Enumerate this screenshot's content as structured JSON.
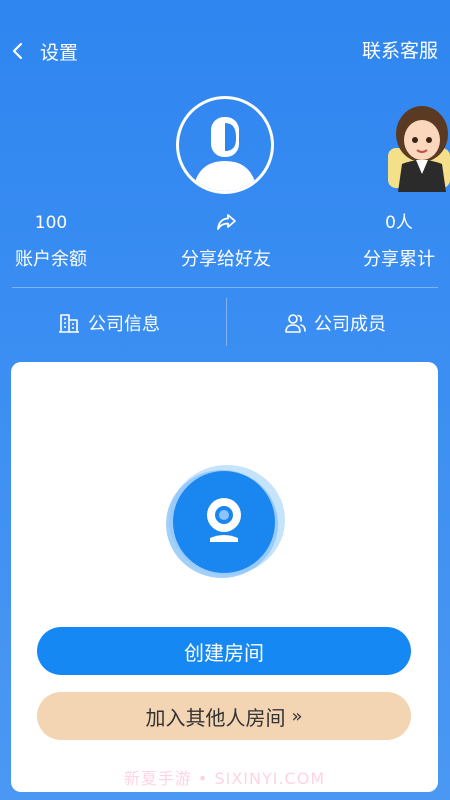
{
  "header": {
    "back_label": "设置",
    "support_label": "联系客服"
  },
  "stats": {
    "balance_value": "100",
    "balance_label": "账户余额",
    "share_label": "分享给好友",
    "total_value": "0人",
    "total_label": "分享累计"
  },
  "tabs": [
    {
      "label": "公司信息",
      "icon": "building-icon"
    },
    {
      "label": "公司成员",
      "icon": "members-icon"
    }
  ],
  "main": {
    "create_label": "创建房间",
    "join_label": "加入其他人房间",
    "join_chevron": "»",
    "watermark": "新夏手游 • SIXINYI.COM"
  },
  "colors": {
    "primary": "#1588f3",
    "background": "#3b8ef2",
    "join_button": "#f3d5b3"
  }
}
